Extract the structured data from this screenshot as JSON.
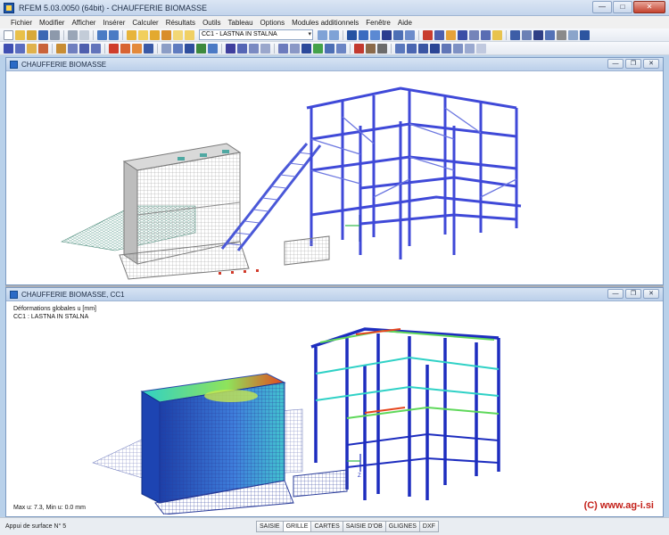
{
  "window": {
    "title": "RFEM 5.03.0050 (64bit) - CHAUFFERIE BIOMASSE"
  },
  "menu": [
    "Fichier",
    "Modifier",
    "Afficher",
    "Insérer",
    "Calculer",
    "Résultats",
    "Outils",
    "Tableau",
    "Options",
    "Modules additionnels",
    "Fenêtre",
    "Aide"
  ],
  "toolbar": {
    "load_case": "CC1 - LASTNA IN STALNA"
  },
  "windows": {
    "top": {
      "title": "CHAUFFERIE BIOMASSE"
    },
    "bottom": {
      "title": "CHAUFFERIE BIOMASSE, CC1",
      "result_label": "Déformations globales u [mm]",
      "load_case_label": "CC1 : LASTNA IN STALNA",
      "max_min": "Max u: 7.3, Min u: 0.0 mm",
      "axis_label": "Z"
    }
  },
  "watermark": "(C) www.ag-i.si",
  "status": {
    "text": "Appui de surface N° 5",
    "tabs": [
      "SAISIE",
      "GRILLE",
      "CARTES",
      "SAISIE D'OB",
      "GLIGNES",
      "DXF"
    ]
  },
  "colors": {
    "structure": "#3f49d8",
    "wall": "#c9c9c9",
    "contour_high": "#e6461e",
    "contour_low": "#1c3fa8"
  }
}
